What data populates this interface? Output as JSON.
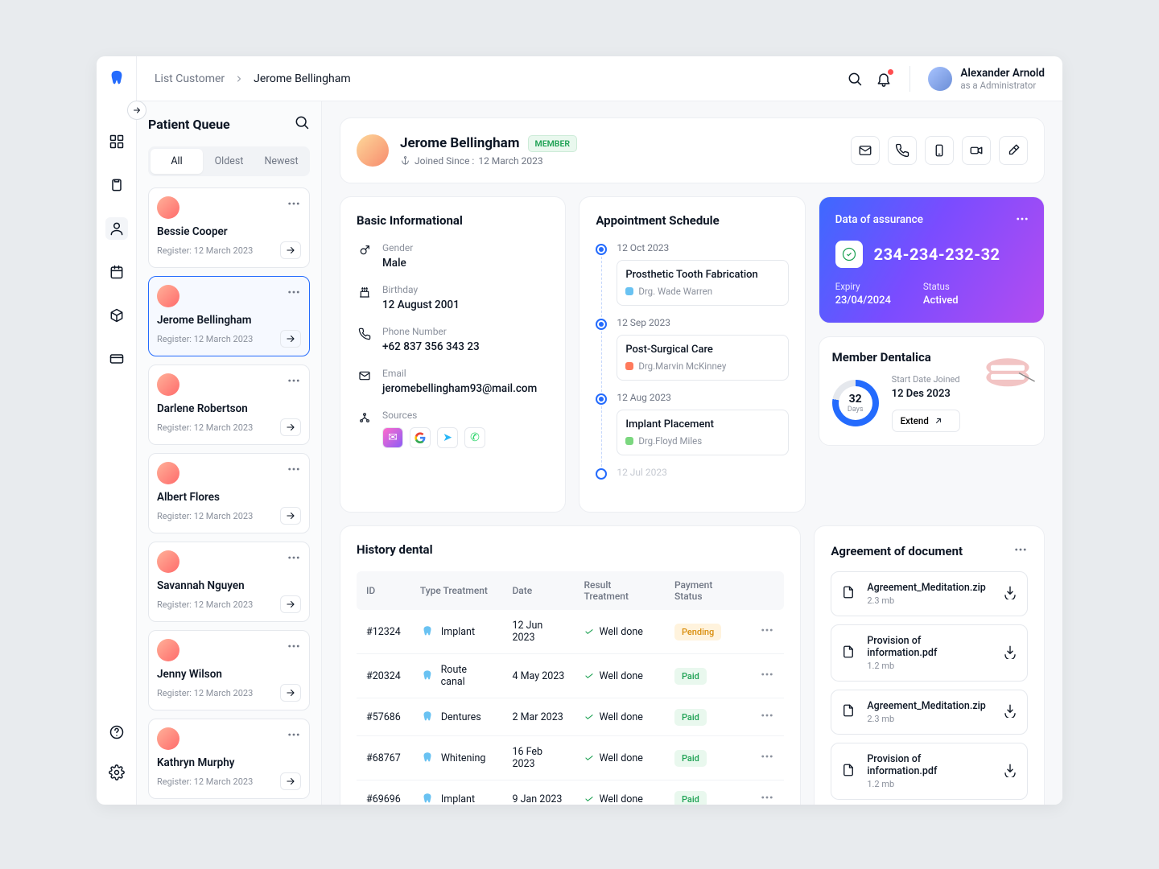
{
  "breadcrumb": {
    "root": "List Customer",
    "current": "Jerome Bellingham"
  },
  "user": {
    "name": "Alexander Arnold",
    "role": "as a Administrator"
  },
  "queue": {
    "title": "Patient Queue",
    "tabs": {
      "all": "All",
      "oldest": "Oldest",
      "newest": "Newest"
    },
    "patients": [
      {
        "name": "Bessie Cooper",
        "register_prefix": "Register:",
        "register_date": "12 March 2023"
      },
      {
        "name": "Jerome Bellingham",
        "register_prefix": "Register:",
        "register_date": "12 March 2023"
      },
      {
        "name": "Darlene Robertson",
        "register_prefix": "Register:",
        "register_date": "12 March 2023"
      },
      {
        "name": "Albert Flores",
        "register_prefix": "Register:",
        "register_date": "12 March 2023"
      },
      {
        "name": "Savannah Nguyen",
        "register_prefix": "Register:",
        "register_date": "12 March 2023"
      },
      {
        "name": "Jenny Wilson",
        "register_prefix": "Register:",
        "register_date": "12 March 2023"
      },
      {
        "name": "Kathryn Murphy",
        "register_prefix": "Register:",
        "register_date": "12 March 2023"
      }
    ]
  },
  "patient": {
    "name": "Jerome Bellingham",
    "badge": "MEMBER",
    "joined_label": "Joined Since :",
    "joined_date": "12 March 2023"
  },
  "basic": {
    "title": "Basic Informational",
    "gender_label": "Gender",
    "gender": "Male",
    "birthday_label": "Birthday",
    "birthday": "12 August 2001",
    "phone_label": "Phone Number",
    "phone": "+62 837 356 343 23",
    "email_label": "Email",
    "email": "jeromebellingham93@mail.com",
    "sources_label": "Sources"
  },
  "appointments": {
    "title": "Appointment Schedule",
    "items": [
      {
        "date": "12 Oct 2023",
        "title": "Prosthetic Tooth Fabrication",
        "doctor": "Drg. Wade Warren",
        "color": "#69c2f2"
      },
      {
        "date": "12 Sep 2023",
        "title": "Post-Surgical Care",
        "doctor": "Drg.Marvin McKinney",
        "color": "#ff7a5c"
      },
      {
        "date": "12 Aug 2023",
        "title": "Implant Placement",
        "doctor": "Drg.Floyd Miles",
        "color": "#7bd77f"
      },
      {
        "date": "12 Jul 2023"
      }
    ]
  },
  "assurance": {
    "title": "Data of assurance",
    "number": "234-234-232-32",
    "expiry_label": "Expiry",
    "expiry": "23/04/2024",
    "status_label": "Status",
    "status": "Actived"
  },
  "member": {
    "title": "Member Dentalica",
    "days": "32",
    "days_label": "Days",
    "start_label": "Start Date Joined",
    "start_date": "12 Des 2023",
    "extend": "Extend"
  },
  "history": {
    "title": "History dental",
    "headers": {
      "id": "ID",
      "type": "Type Treatment",
      "date": "Date",
      "result": "Result Treatment",
      "status": "Payment Status"
    },
    "rows": [
      {
        "id": "#12324",
        "type": "Implant",
        "date": "12 Jun 2023",
        "result": "Well done",
        "status": "Pending"
      },
      {
        "id": "#20324",
        "type": "Route canal",
        "date": "4 May 2023",
        "result": "Well done",
        "status": "Paid"
      },
      {
        "id": "#57686",
        "type": "Dentures",
        "date": "2 Mar 2023",
        "result": "Well done",
        "status": "Paid"
      },
      {
        "id": "#68767",
        "type": "Whitening",
        "date": "16 Feb 2023",
        "result": "Well done",
        "status": "Paid"
      },
      {
        "id": "#69696",
        "type": "Implant",
        "date": "9 Jan 2023",
        "result": "Well done",
        "status": "Paid"
      }
    ]
  },
  "agreement": {
    "title": "Agreement of document",
    "docs": [
      {
        "name": "Agreement_Meditation.zip",
        "size": "2.3 mb"
      },
      {
        "name": "Provision of information.pdf",
        "size": "1.2 mb"
      },
      {
        "name": "Agreement_Meditation.zip",
        "size": "2.3 mb"
      },
      {
        "name": "Provision of information.pdf",
        "size": "1.2 mb"
      }
    ]
  }
}
